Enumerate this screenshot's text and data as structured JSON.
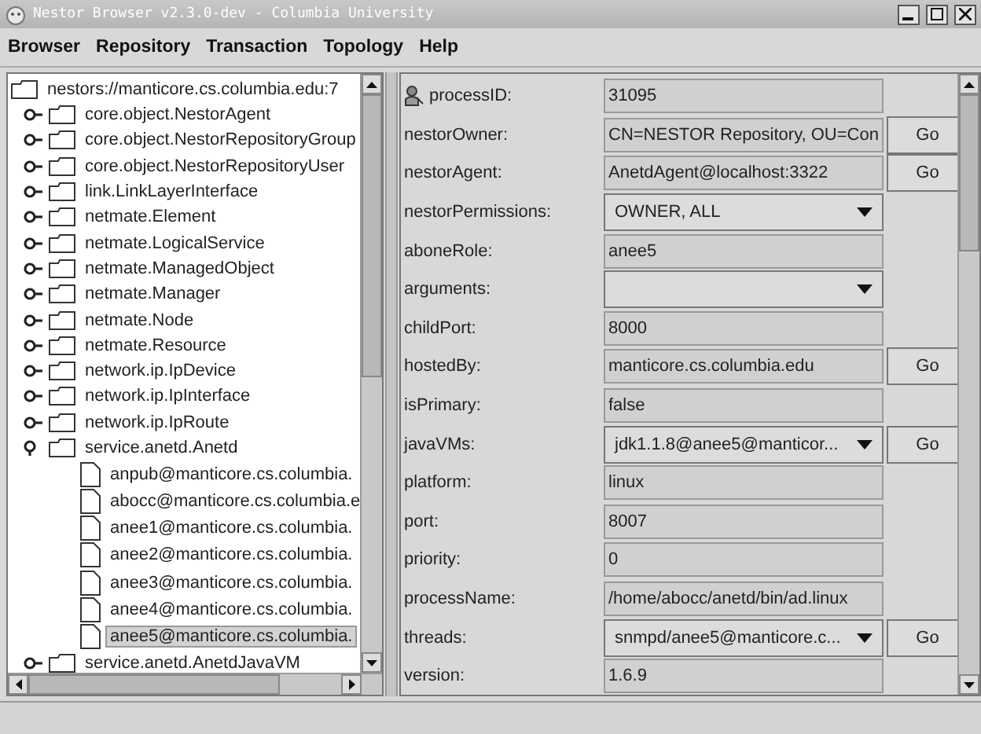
{
  "window": {
    "title": "Nestor Browser v2.3.0-dev - Columbia University"
  },
  "menu": [
    "Browser",
    "Repository",
    "Transaction",
    "Topology",
    "Help"
  ],
  "tree": {
    "label": "nestors://manticore.cs.columbia.edu:7",
    "children": [
      {
        "label": "core.object.NestorAgent",
        "expanded": false
      },
      {
        "label": "core.object.NestorRepositoryGroup",
        "expanded": false
      },
      {
        "label": "core.object.NestorRepositoryUser",
        "expanded": false
      },
      {
        "label": "link.LinkLayerInterface",
        "expanded": false
      },
      {
        "label": "netmate.Element",
        "expanded": false
      },
      {
        "label": "netmate.LogicalService",
        "expanded": false
      },
      {
        "label": "netmate.ManagedObject",
        "expanded": false
      },
      {
        "label": "netmate.Manager",
        "expanded": false
      },
      {
        "label": "netmate.Node",
        "expanded": false
      },
      {
        "label": "netmate.Resource",
        "expanded": false
      },
      {
        "label": "network.ip.IpDevice",
        "expanded": false
      },
      {
        "label": "network.ip.IpInterface",
        "expanded": false
      },
      {
        "label": "network.ip.IpRoute",
        "expanded": false
      },
      {
        "label": "service.anetd.Anetd",
        "expanded": true,
        "children": [
          {
            "label": "anpub@manticore.cs.columbia.",
            "selected": false
          },
          {
            "label": "abocc@manticore.cs.columbia.e",
            "selected": false
          },
          {
            "label": "anee1@manticore.cs.columbia.",
            "selected": false
          },
          {
            "label": "anee2@manticore.cs.columbia.",
            "selected": false
          },
          {
            "label": "anee3@manticore.cs.columbia.",
            "selected": false
          },
          {
            "label": "anee4@manticore.cs.columbia.",
            "selected": false
          },
          {
            "label": "anee5@manticore.cs.columbia.",
            "selected": true
          }
        ]
      },
      {
        "label": "service.anetd.AnetdJavaVM",
        "expanded": false
      }
    ]
  },
  "properties": [
    {
      "label": "processID:",
      "value": "31095",
      "kind": "text"
    },
    {
      "label": "nestorOwner:",
      "value": "CN=NESTOR Repository, OU=Con",
      "kind": "text",
      "button": "Go"
    },
    {
      "label": "nestorAgent:",
      "value": "AnetdAgent@localhost:3322",
      "kind": "text",
      "button": "Go"
    },
    {
      "label": "nestorPermissions:",
      "value": "OWNER,  ALL",
      "kind": "combo"
    },
    {
      "label": "aboneRole:",
      "value": "anee5",
      "kind": "text"
    },
    {
      "label": "arguments:",
      "kind": "combo"
    },
    {
      "label": "childPort:",
      "value": "8000",
      "kind": "text"
    },
    {
      "label": "hostedBy:",
      "value": "manticore.cs.columbia.edu",
      "kind": "text",
      "button": "Go"
    },
    {
      "label": "isPrimary:",
      "value": "false",
      "kind": "text"
    },
    {
      "label": "javaVMs:",
      "value": "jdk1.1.8@anee5@manticor...",
      "kind": "combo",
      "button": "Go"
    },
    {
      "label": "platform:",
      "value": "linux",
      "kind": "text"
    },
    {
      "label": "port:",
      "value": "8007",
      "kind": "text"
    },
    {
      "label": "priority:",
      "value": "0",
      "kind": "text"
    },
    {
      "label": "processName:",
      "value": "/home/abocc/anetd/bin/ad.linux",
      "kind": "text"
    },
    {
      "label": "threads:",
      "value": "snmpd/anee5@manticore.c...",
      "kind": "combo",
      "button": "Go"
    },
    {
      "label": "version:",
      "value": "1.6.9",
      "kind": "text"
    }
  ]
}
